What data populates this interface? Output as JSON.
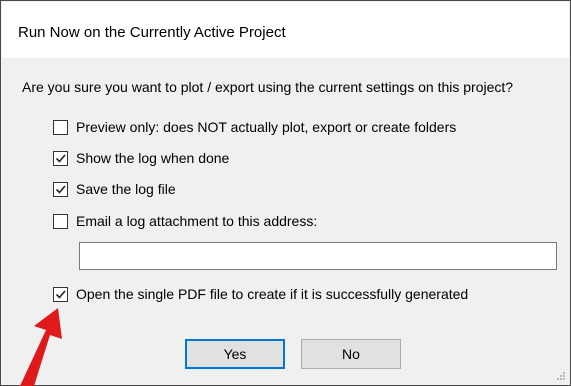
{
  "dialog": {
    "title": "Run Now on the Currently Active Project",
    "prompt": "Are you sure you want to plot / export using the current settings on this project?"
  },
  "options": [
    {
      "label": "Preview only:  does NOT actually plot, export or create folders",
      "checked": false
    },
    {
      "label": "Show the log when done",
      "checked": true
    },
    {
      "label": "Save the log file",
      "checked": true
    },
    {
      "label": "Email a log attachment to this address:",
      "checked": false
    },
    {
      "label": "Open the single PDF file to create if it is successfully generated",
      "checked": true
    }
  ],
  "email": {
    "value": ""
  },
  "buttons": {
    "yes": "Yes",
    "no": "No"
  },
  "colors": {
    "annotation_arrow": "#e0191b",
    "default_button_border": "#0078d7"
  },
  "icons": {
    "annotation": "red-arrow-icon",
    "check": "checkmark-icon"
  }
}
